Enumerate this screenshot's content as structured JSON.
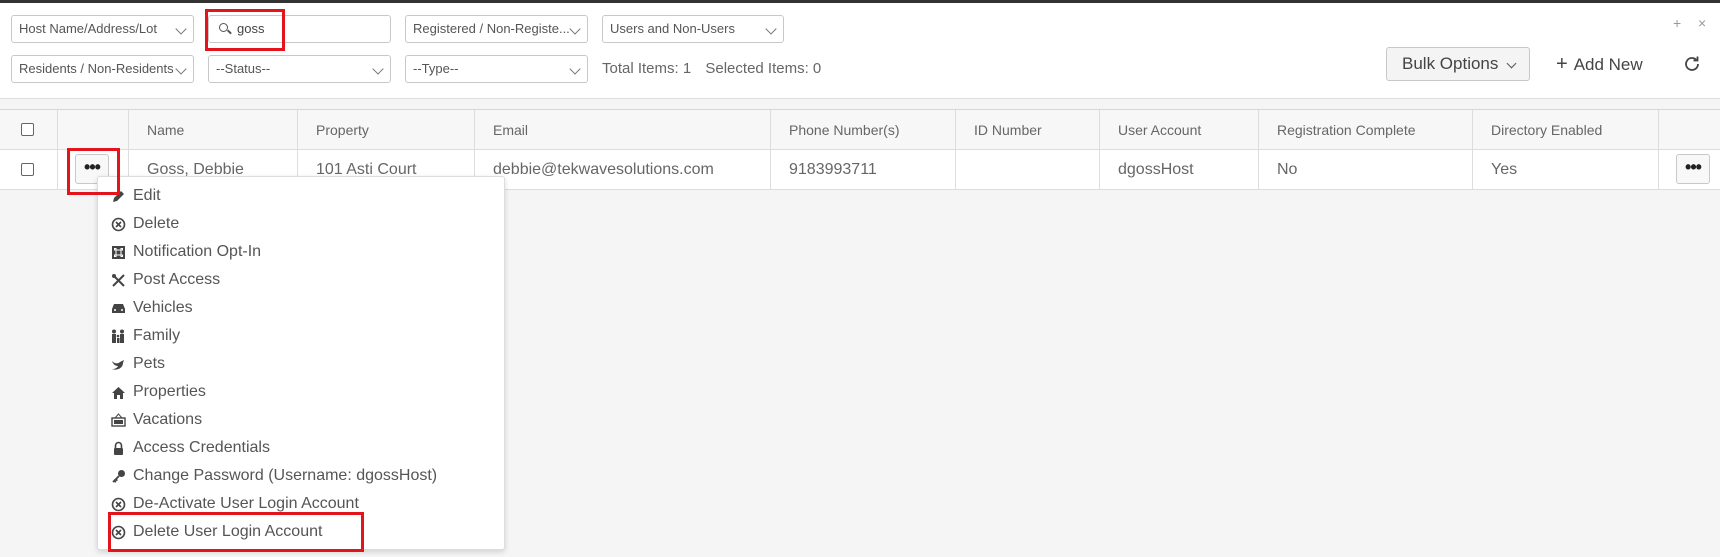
{
  "filters": {
    "host_select": "Host Name/Address/Lot",
    "search_value": "goss",
    "registered_select": "Registered / Non-Registe...",
    "users_select": "Users and Non-Users",
    "residents_select": "Residents / Non-Residents",
    "status_select": "--Status--",
    "type_select": "--Type--"
  },
  "totals": {
    "total_items": "Total Items: 1",
    "selected_items": "Selected Items: 0"
  },
  "toolbar": {
    "bulk_options": "Bulk Options",
    "add_new": "Add New"
  },
  "window": {
    "maximize": "+",
    "close": "×"
  },
  "table": {
    "headers": [
      "Name",
      "Property",
      "Email",
      "Phone Number(s)",
      "ID Number",
      "User Account",
      "Registration Complete",
      "Directory Enabled"
    ],
    "row": {
      "name": "Goss, Debbie",
      "property": "101 Asti Court",
      "email": "debbie@tekwavesolutions.com",
      "phone": "9183993711",
      "id_number": "",
      "user_account": "dgossHost",
      "registration_complete": "No",
      "directory_enabled": "Yes"
    },
    "actions_label": "•••"
  },
  "menu": {
    "items": [
      {
        "label": "Edit",
        "icon": "pencil-icon"
      },
      {
        "label": "Delete",
        "icon": "circle-x-icon"
      },
      {
        "label": "Notification Opt-In",
        "icon": "command-icon"
      },
      {
        "label": "Post Access",
        "icon": "tools-icon"
      },
      {
        "label": "Vehicles",
        "icon": "car-icon"
      },
      {
        "label": "Family",
        "icon": "family-icon"
      },
      {
        "label": "Pets",
        "icon": "bird-icon"
      },
      {
        "label": "Properties",
        "icon": "home-icon"
      },
      {
        "label": "Vacations",
        "icon": "out-sign-icon"
      },
      {
        "label": "Access Credentials",
        "icon": "lock-icon"
      },
      {
        "label": "Change Password (Username: dgossHost)",
        "icon": "key-icon"
      },
      {
        "label": "De-Activate User Login Account",
        "icon": "circle-x-icon"
      },
      {
        "label": "Delete User Login Account",
        "icon": "circle-x-icon"
      }
    ]
  },
  "colors": {
    "highlight": "#e3141b",
    "border": "#c8c8c8",
    "text": "#555555"
  }
}
